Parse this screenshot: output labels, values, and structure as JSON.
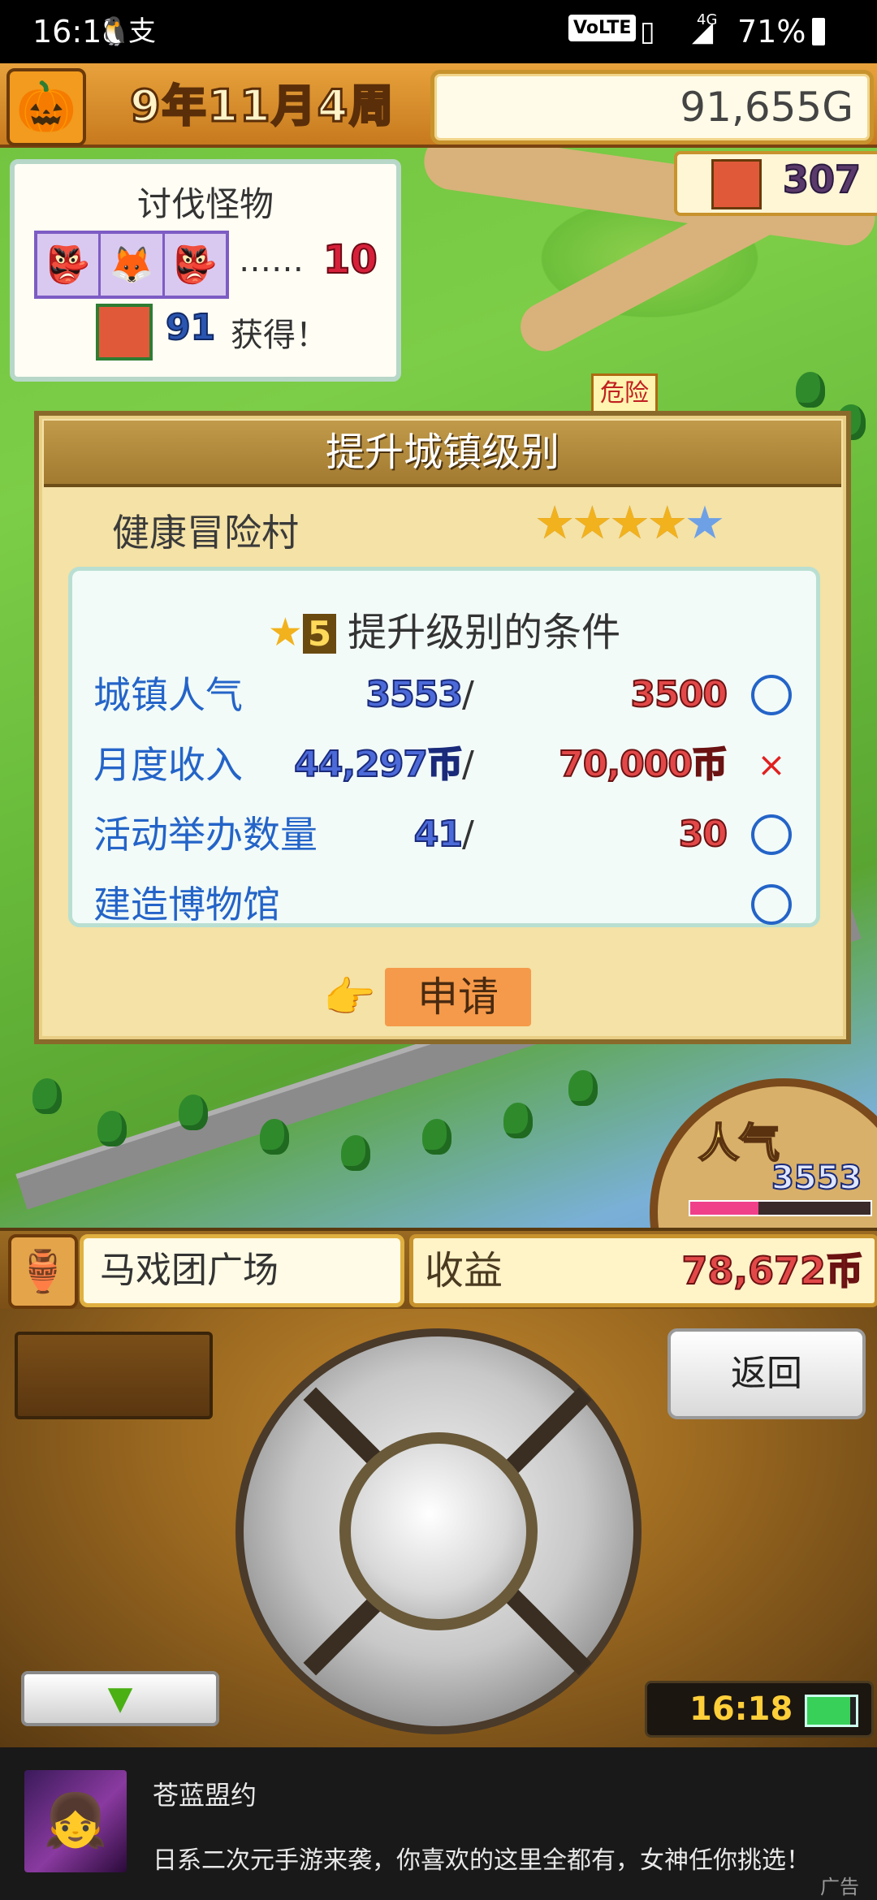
{
  "status_bar": {
    "time": "16:18",
    "notif_icons": [
      "qq-penguin-icon",
      "alipay-icon"
    ],
    "network": "VoLTE",
    "signal_label": "4G",
    "battery_percent": "71%"
  },
  "hud": {
    "date": "9年11月4周",
    "money": "91,655G",
    "popularity_badge": "307"
  },
  "quest": {
    "title": "讨伐怪物",
    "monsters": [
      "green-goblin",
      "orange-beast",
      "green-goblin"
    ],
    "dots": "……",
    "target_count": "10",
    "reward_amount": "91",
    "reward_text": "获得！"
  },
  "map_sign": "危险",
  "dialog": {
    "title": "提升城镇级别",
    "town_name": "健康冒险村",
    "stars_filled": 4,
    "stars_total": 5,
    "conditions_heading": "提升级别的条件",
    "next_level": "5",
    "conditions": [
      {
        "label": "城镇人气",
        "current": "3553",
        "slash": "/",
        "required": "3500",
        "status": "circle"
      },
      {
        "label": "月度收入",
        "current": "44,297币",
        "slash": "/",
        "required": "70,000币",
        "status": "cross"
      },
      {
        "label": "活动举办数量",
        "current": "41",
        "slash": "/",
        "required": "30",
        "status": "circle"
      },
      {
        "label": "建造博物馆",
        "current": "",
        "slash": "",
        "required": "",
        "status": "circle"
      }
    ],
    "cross_symbol": "×",
    "apply_label": "申请"
  },
  "popularity_wheel": {
    "label": "人气",
    "value": "3553",
    "fill_percent": 0.38
  },
  "info_bar": {
    "facility": "马戏团广场",
    "income_label": "收益",
    "income_value": "78,672币"
  },
  "controls": {
    "back_label": "返回",
    "clock": "16:18"
  },
  "ad": {
    "title": "苍蓝盟约",
    "description": "日系二次元手游来袭，你喜欢的这里全都有，女神任你挑选！",
    "tag": "广告"
  },
  "colors": {
    "accent_blue": "#2464c8",
    "required_red": "#e24848",
    "apply_orange": "#f59a4a"
  }
}
